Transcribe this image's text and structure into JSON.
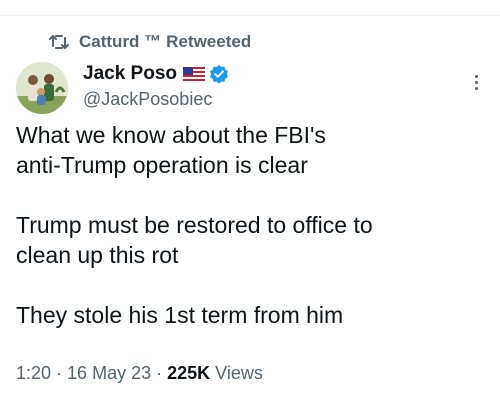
{
  "retweet": {
    "icon": "retweet-icon",
    "retweeter": "Catturd ™",
    "label": "Retweeted"
  },
  "author": {
    "display_name": "Jack Poso",
    "flag": "us-flag-icon",
    "verified_icon": "verified-badge-icon",
    "handle": "@JackPosobiec"
  },
  "tweet": {
    "line1": "What we know about the FBI's",
    "line2": "anti-Trump operation is clear",
    "line3": "Trump must be restored to office to",
    "line4": "clean up this rot",
    "line5": "They stole his 1st term from him"
  },
  "meta": {
    "time": "1:20",
    "date": "16 May 23",
    "views_count": "225K",
    "views_label": "Views",
    "separator": "·"
  },
  "colors": {
    "text": "#0f1419",
    "secondary": "#536471",
    "verified": "#1d9bf0"
  }
}
